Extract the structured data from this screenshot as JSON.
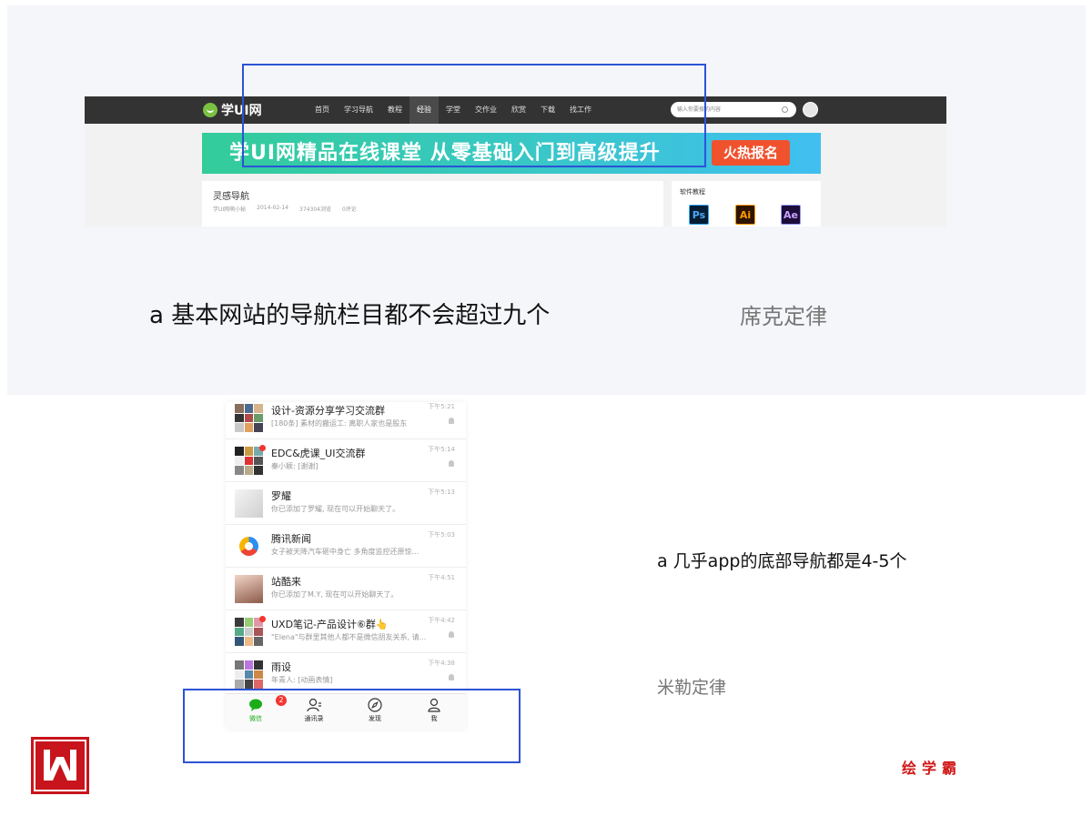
{
  "website": {
    "logo_text": "学UI网",
    "nav": [
      "首页",
      "学习导航",
      "教程",
      "经验",
      "学堂",
      "交作业",
      "欣赏",
      "下载",
      "找工作"
    ],
    "active_nav": "经验",
    "search_placeholder": "输入你要搜的内容",
    "banner_text": "学UI网精品在线课堂 从零基础入门到高级提升",
    "banner_button": "火热报名",
    "article_title": "灵感导航",
    "article_meta": {
      "author": "学UI网萌小秘",
      "date": "2014-02-14",
      "views": "374304浏览",
      "comments": "0评论"
    },
    "side_title": "软件教程",
    "software": [
      "Ps",
      "Ai",
      "Ae"
    ]
  },
  "caption_top": "a 基本网站的导航栏目都不会超过九个",
  "law_top": "席克定律",
  "wechat": {
    "chats": [
      {
        "name": "设计-资源分享学习交流群",
        "msg": "[180条] 素材的搬运工: 离职人家也是股东",
        "time": "下午5:21"
      },
      {
        "name": "EDC&虎课_UI交流群",
        "msg": "秦小颖: [谢谢]",
        "time": "下午5:14"
      },
      {
        "name": "罗耀",
        "msg": "你已添加了罗耀, 现在可以开始聊天了。",
        "time": "下午5:13"
      },
      {
        "name": "腾讯新闻",
        "msg": "女子被天降汽车砸中身亡 多角度监控还原惊...",
        "time": "下午5:03"
      },
      {
        "name": "站酷来",
        "msg": "你已添加了M.Y, 现在可以开始聊天了。",
        "time": "下午4:51"
      },
      {
        "name": "UXD笔记-产品设计⑥群👆",
        "msg": "\"Elena\"与群里其他人都不是微信朋友关系, 请...",
        "time": "下午4:42"
      },
      {
        "name": "雨设",
        "msg": "年青人: [动画表情]",
        "time": "下午4:38"
      }
    ],
    "tabs": [
      "微信",
      "通讯录",
      "发现",
      "我"
    ],
    "badge": "2"
  },
  "caption_bottom": "a 几乎app的底部导航都是4-5个",
  "law_bottom": "米勒定律",
  "brand": "绘学霸",
  "colors": {
    "highlight": "#2b54d6",
    "brand_red": "#c8141c",
    "wechat_green": "#1aad19"
  }
}
